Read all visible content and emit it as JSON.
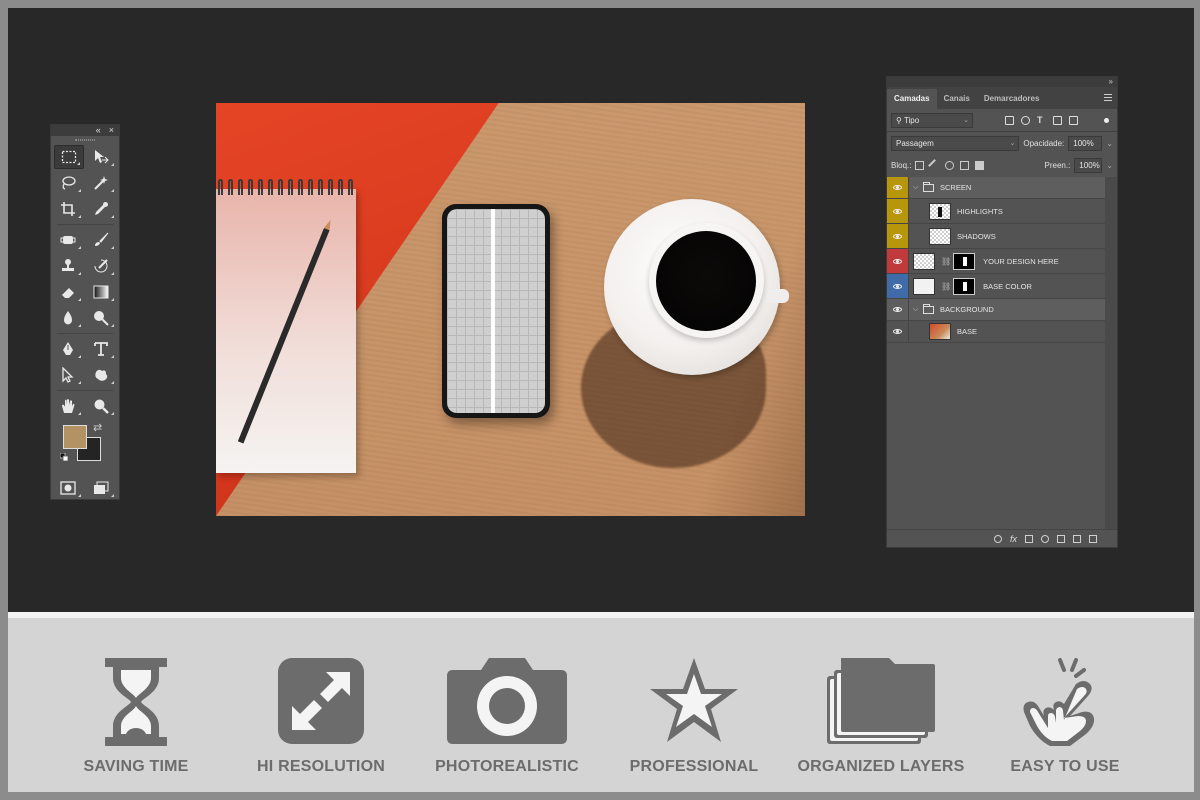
{
  "layers_panel": {
    "tabs": [
      "Camadas",
      "Canais",
      "Demarcadores"
    ],
    "filter_value": "Tipo",
    "blend_mode": "Passagem",
    "opacity_label": "Opacidade:",
    "opacity_value": "100%",
    "lock_label": "Bloq.:",
    "fill_label": "Preen.:",
    "fill_value": "100%",
    "layers": [
      {
        "name": "SCREEN",
        "kind": "group",
        "color": "#b8960c"
      },
      {
        "name": "HIGHLIGHTS",
        "kind": "layer",
        "color": "#b8960c"
      },
      {
        "name": "SHADOWS",
        "kind": "layer",
        "color": "#b8960c"
      },
      {
        "name": "YOUR DESIGN HERE",
        "kind": "smart",
        "color": "#c0393b"
      },
      {
        "name": "BASE COLOR",
        "kind": "fill",
        "color": "#3f6ca8"
      },
      {
        "name": "BACKGROUND",
        "kind": "group",
        "color": "#535353"
      },
      {
        "name": "BASE",
        "kind": "photo",
        "color": "#535353"
      }
    ]
  },
  "tools_panel": {
    "foreground_color": "#b39364",
    "background_color": "#242424",
    "tools": [
      "rect-marquee",
      "move",
      "lasso",
      "magic-wand",
      "crop",
      "eyedropper",
      "healing",
      "brush",
      "stamp",
      "history-brush",
      "eraser",
      "gradient",
      "blur",
      "dodge",
      "pen",
      "type",
      "path-select",
      "shape",
      "hand",
      "zoom"
    ]
  },
  "features": [
    {
      "label": "SAVING TIME",
      "icon": "hourglass-icon"
    },
    {
      "label": "HI RESOLUTION",
      "icon": "expand-arrows-icon"
    },
    {
      "label": "PHOTOREALISTIC",
      "icon": "camera-icon"
    },
    {
      "label": "PROFESSIONAL",
      "icon": "star-icon"
    },
    {
      "label": "ORGANIZED LAYERS",
      "icon": "stacked-folders-icon"
    },
    {
      "label": "EASY TO USE",
      "icon": "tap-hand-icon"
    }
  ]
}
